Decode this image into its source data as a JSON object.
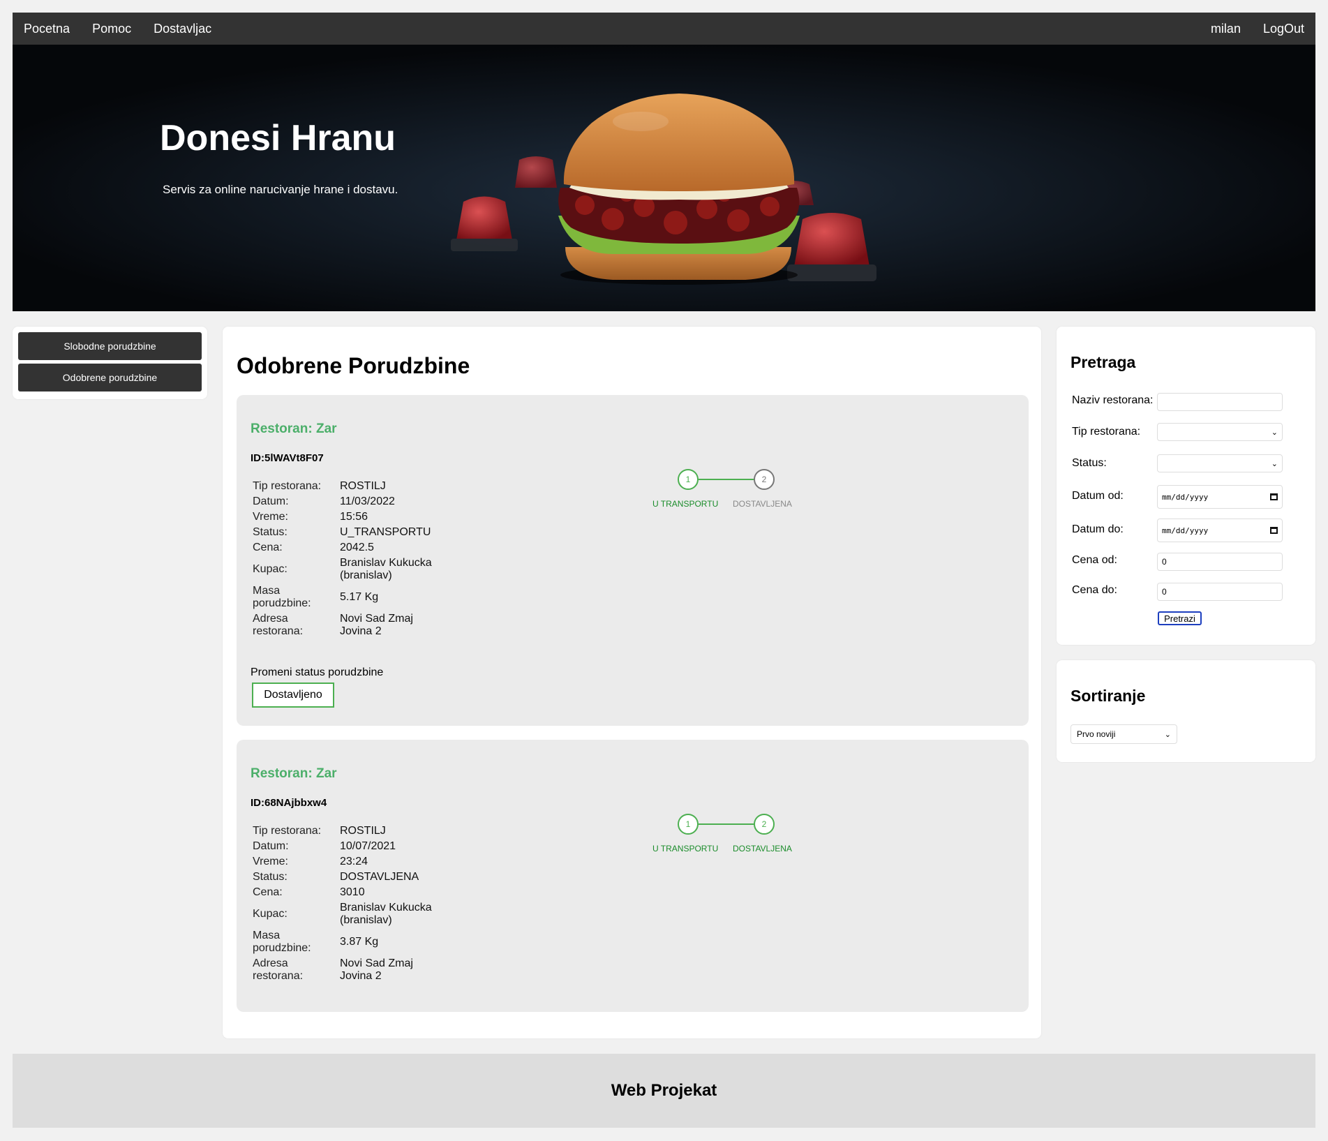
{
  "nav": {
    "left": [
      "Pocetna",
      "Pomoc",
      "Dostavljac"
    ],
    "username": "milan",
    "logout": "LogOut"
  },
  "hero": {
    "title": "Donesi Hranu",
    "subtitle": "Servis za online narucivanje hrane i dostavu."
  },
  "sidebar": {
    "buttons": [
      "Slobodne porudzbine",
      "Odobrene porudzbine"
    ]
  },
  "main": {
    "title": "Odobrene Porudzbine",
    "orders": [
      {
        "restaurant": "Restoran: Zar",
        "id": "ID:5lWAVt8F07",
        "fields": [
          {
            "label": "Tip restorana:",
            "value": "ROSTILJ"
          },
          {
            "label": "Datum:",
            "value": "11/03/2022"
          },
          {
            "label": "Vreme:",
            "value": "15:56"
          },
          {
            "label": "Status:",
            "value": "U_TRANSPORTU"
          },
          {
            "label": "Cena:",
            "value": "2042.5"
          },
          {
            "label": "Kupac:",
            "value": "Branislav Kukucka (branislav)"
          },
          {
            "label": "Masa porudzbine:",
            "value": "5.17 Kg"
          },
          {
            "label": "Adresa restorana:",
            "value": "Novi Sad Zmaj Jovina 2"
          }
        ],
        "steps": [
          {
            "num": "1",
            "label": "U TRANSPORTU",
            "done": true
          },
          {
            "num": "2",
            "label": "DOSTAVLJENA",
            "done": false
          }
        ],
        "change_label": "Promeni status porudzbine",
        "change_button": "Dostavljeno"
      },
      {
        "restaurant": "Restoran: Zar",
        "id": "ID:68NAjbbxw4",
        "fields": [
          {
            "label": "Tip restorana:",
            "value": "ROSTILJ"
          },
          {
            "label": "Datum:",
            "value": "10/07/2021"
          },
          {
            "label": "Vreme:",
            "value": "23:24"
          },
          {
            "label": "Status:",
            "value": "DOSTAVLJENA"
          },
          {
            "label": "Cena:",
            "value": "3010"
          },
          {
            "label": "Kupac:",
            "value": "Branislav Kukucka (branislav)"
          },
          {
            "label": "Masa porudzbine:",
            "value": "3.87 Kg"
          },
          {
            "label": "Adresa restorana:",
            "value": "Novi Sad Zmaj Jovina 2"
          }
        ],
        "steps": [
          {
            "num": "1",
            "label": "U TRANSPORTU",
            "done": true
          },
          {
            "num": "2",
            "label": "DOSTAVLJENA",
            "done": true
          }
        ]
      }
    ]
  },
  "search": {
    "title": "Pretraga",
    "restaurant_name_label": "Naziv restorana:",
    "restaurant_name_value": "",
    "restaurant_type_label": "Tip restorana:",
    "restaurant_type_value": "",
    "status_label": "Status:",
    "status_value": "",
    "date_from_label": "Datum od:",
    "date_from_placeholder": "mm/dd/yyyy",
    "date_to_label": "Datum do:",
    "date_to_placeholder": "mm/dd/yyyy",
    "price_from_label": "Cena od:",
    "price_from_value": "0",
    "price_to_label": "Cena do:",
    "price_to_value": "0",
    "button": "Pretrazi"
  },
  "sort": {
    "title": "Sortiranje",
    "selected": "Prvo noviji"
  },
  "footer": {
    "title": "Web Projekat"
  },
  "colors": {
    "navbar": "#333333",
    "accent_green": "#4caf50",
    "restaurant_green": "#4caf6a",
    "card_bg": "#ebebeb",
    "footer_bg": "#dddddd"
  }
}
